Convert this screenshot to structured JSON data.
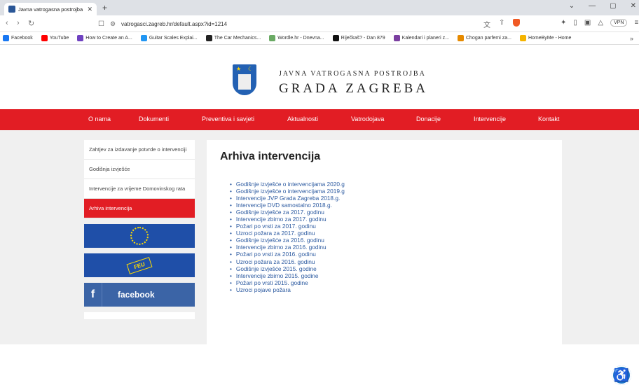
{
  "browser": {
    "tab_title": "Javna vatrogasna postrojba Gr...",
    "url": "vatrogasci.zagreb.hr/default.aspx?id=1214",
    "vpn_label": "VPN",
    "bookmarks": [
      {
        "label": "Facebook",
        "color": "#1877f2"
      },
      {
        "label": "YouTube",
        "color": "#ff0000"
      },
      {
        "label": "How to Create an A...",
        "color": "#6f42c1"
      },
      {
        "label": "Guitar Scales Explai...",
        "color": "#2196f3"
      },
      {
        "label": "The Car Mechanics...",
        "color": "#222222"
      },
      {
        "label": "Wordle.hr - Dnevna...",
        "color": "#6aaa64"
      },
      {
        "label": "Riječkaš? - Dan 879",
        "color": "#111111"
      },
      {
        "label": "Kalendari i planeri z...",
        "color": "#7b3fa0"
      },
      {
        "label": "Chogan parfemi za...",
        "color": "#e68a00"
      },
      {
        "label": "HomeByMe - Home",
        "color": "#f5b400"
      }
    ]
  },
  "site": {
    "brand_line1": "JAVNA VATROGASNA POSTROJBA",
    "brand_line2": "GRADA ZAGREBA",
    "menu": [
      "O nama",
      "Dokumenti",
      "Preventiva i savjeti",
      "Aktualnosti",
      "Vatrodojava",
      "Donacije",
      "Intervencije",
      "Kontakt"
    ],
    "sidebar": [
      {
        "label": "Zahtjev za izdavanje potvrde o intervenciji",
        "active": false
      },
      {
        "label": "Godišnja izvješće",
        "active": false
      },
      {
        "label": "Intervencije za vrijeme Domovinskog rata",
        "active": false
      },
      {
        "label": "Arhiva intervencija",
        "active": true
      }
    ],
    "facebook_label": "facebook",
    "feu_label": "FEU",
    "page_title": "Arhiva intervencija",
    "links": [
      "Godišnje izvješće o intervencijama 2020.g",
      "Godišnje izvješće o intervencijama 2019.g",
      "Intervencije JVP Grada Zagreba  2018.g.",
      "Intervencije DVD samostalno 2018.g.",
      "Godišnje izvješće za 2017. godinu",
      "Intervencije zbirno  za 2017. godinu",
      "Požari po vrsti za  2017. godinu",
      "Uzroci požara za 2017. godinu",
      "Godišnje izvješće za 2016. godinu",
      "Intervencije zbirno  za 2016. godinu",
      "Požari po vrsti za  2016. godinu",
      "Uzroci požara za 2016. godinu",
      "Godišnje izvješće 2015. godine",
      "Intervencije zbirno 2015. godine",
      "Požari po vrsti 2015. godine",
      "Uzroci pojave požara"
    ]
  }
}
